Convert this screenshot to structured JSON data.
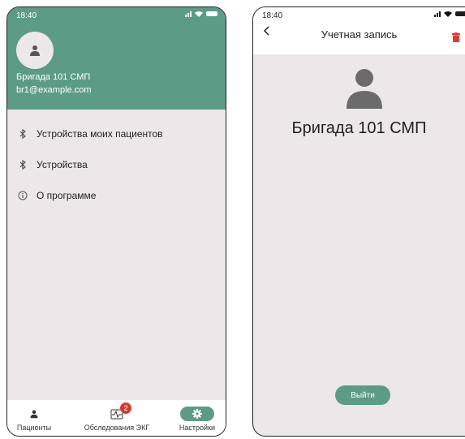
{
  "left_screen": {
    "status_time": "18:40",
    "drawer": {
      "name": "Бригада 101 СМП",
      "email": "br1@example.com"
    },
    "menu": [
      {
        "label": "Устройства моих пациентов",
        "icon": "bluetooth-icon"
      },
      {
        "label": "Устройства",
        "icon": "bluetooth-icon"
      },
      {
        "label": "О программе",
        "icon": "info-icon"
      }
    ],
    "bottom_nav": [
      {
        "label": "Пациенты",
        "icon": "person-icon"
      },
      {
        "label": "Обследования ЭКГ",
        "icon": "ecg-icon",
        "badge": "2"
      },
      {
        "label": "Настройки",
        "icon": "gear-icon",
        "active": true
      }
    ]
  },
  "right_screen": {
    "status_time": "18:40",
    "title": "Учетная запись",
    "account_name": "Бригада 101 СМП",
    "logout_label": "Выйти"
  },
  "colors": {
    "accent": "#5c9c87",
    "background": "#ece7e8",
    "badge": "#d23b2e",
    "delete": "#e53935"
  }
}
